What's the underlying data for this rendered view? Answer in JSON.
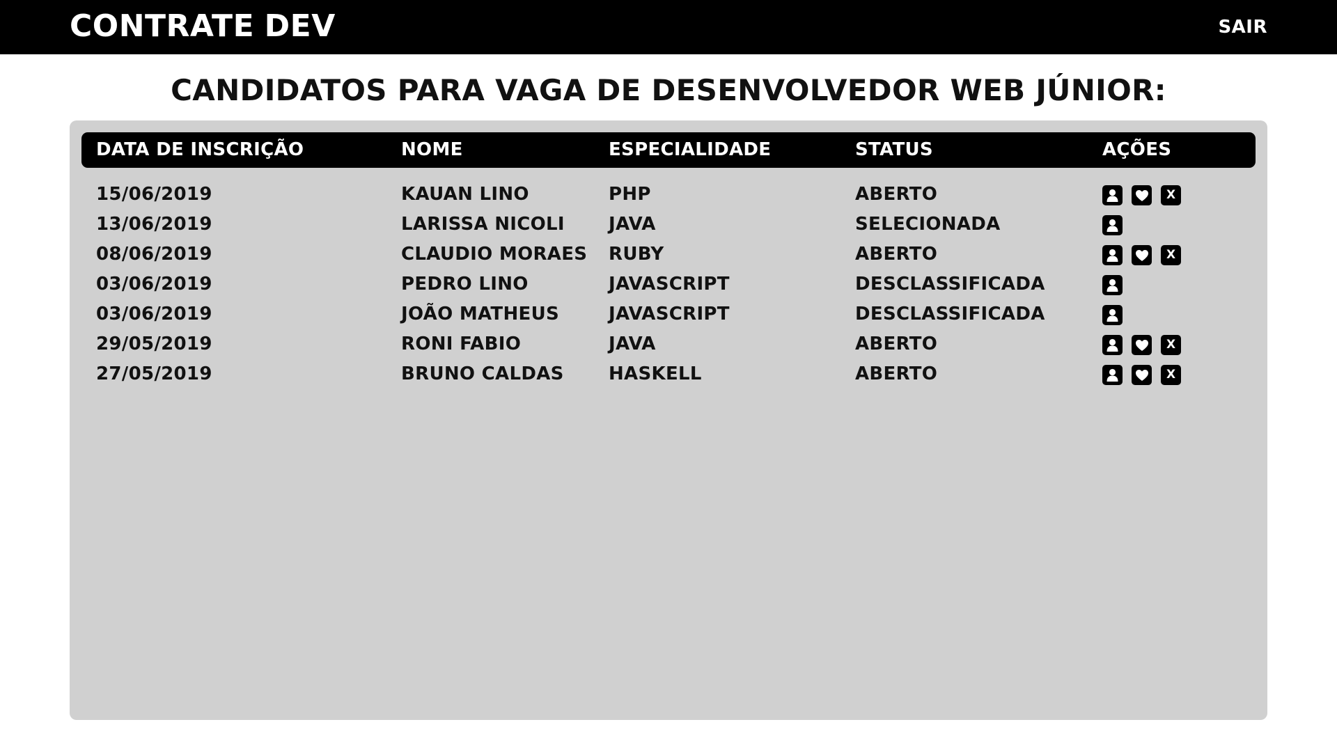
{
  "app": {
    "brand_light": "CONTRATE",
    "brand_bold": "DEV",
    "logout_label": "SAIR"
  },
  "page": {
    "title": "CANDIDATOS PARA VAGA DE DESENVOLVEDOR WEB JÚNIOR:"
  },
  "table": {
    "headers": {
      "date": "DATA DE INSCRIÇÃO",
      "name": "NOME",
      "specialty": "ESPECIALIDADE",
      "status": "STATUS",
      "actions": "AÇÕES"
    },
    "rows": [
      {
        "date": "15/06/2019",
        "name": "KAUAN LINO",
        "specialty": "PHP",
        "status": "ABERTO",
        "actions": [
          "profile-icon",
          "heart-icon",
          "close-icon"
        ]
      },
      {
        "date": "13/06/2019",
        "name": "LARISSA NICOLI",
        "specialty": "JAVA",
        "status": "SELECIONADA",
        "actions": [
          "profile-icon"
        ]
      },
      {
        "date": "08/06/2019",
        "name": "CLAUDIO MORAES",
        "specialty": "RUBY",
        "status": "ABERTO",
        "actions": [
          "profile-icon",
          "heart-icon",
          "close-icon"
        ]
      },
      {
        "date": "03/06/2019",
        "name": "PEDRO LINO",
        "specialty": "JAVASCRIPT",
        "status": "DESCLASSIFICADA",
        "actions": [
          "profile-icon"
        ]
      },
      {
        "date": "03/06/2019",
        "name": "JOÃO MATHEUS",
        "specialty": "JAVASCRIPT",
        "status": "DESCLASSIFICADA",
        "actions": [
          "profile-icon"
        ]
      },
      {
        "date": "29/05/2019",
        "name": "RONI FABIO",
        "specialty": "JAVA",
        "status": "ABERTO",
        "actions": [
          "profile-icon",
          "heart-icon",
          "close-icon"
        ]
      },
      {
        "date": "27/05/2019",
        "name": "BRUNO CALDAS",
        "specialty": "HASKELL",
        "status": "ABERTO",
        "actions": [
          "profile-icon",
          "heart-icon",
          "close-icon"
        ]
      }
    ],
    "close_glyph": "X"
  },
  "colors": {
    "topbar": "#000000",
    "panel": "#d0d0d0",
    "header_row": "#000000",
    "text": "#111111"
  }
}
